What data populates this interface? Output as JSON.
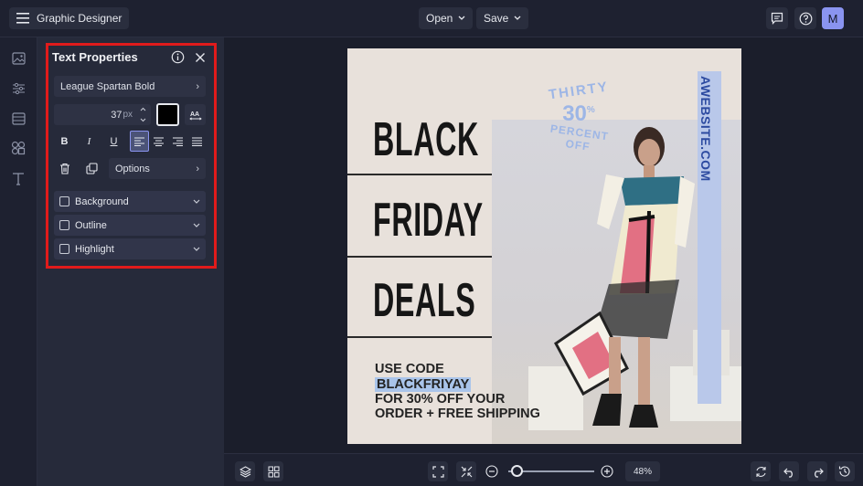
{
  "app": {
    "title": "Graphic Designer",
    "avatar_letter": "M"
  },
  "toolbar": {
    "open_label": "Open",
    "save_label": "Save"
  },
  "icons": [
    "hamburger-icon",
    "chevron-down-icon",
    "comment-icon",
    "help-icon",
    "image-icon",
    "sliders-icon",
    "layout-icon",
    "shapes-icon",
    "text-icon",
    "info-icon",
    "close-icon",
    "trash-icon",
    "duplicate-icon",
    "layers-icon",
    "grid-icon",
    "fit-icon",
    "shrink-icon",
    "zoom-out-icon",
    "zoom-in-icon",
    "refresh-icon",
    "undo-icon",
    "redo-icon",
    "history-icon"
  ],
  "text_properties": {
    "title": "Text Properties",
    "font": "League Spartan Bold",
    "size_value": "37",
    "size_unit": "px",
    "color": "#000000",
    "options_label": "Options",
    "accordions": [
      "Background",
      "Outline",
      "Highlight"
    ],
    "format_buttons": [
      "B",
      "I",
      "U"
    ]
  },
  "design": {
    "lines": [
      "BLACK",
      "FRIDAY",
      "DEALS"
    ],
    "promo": {
      "line1": "USE CODE",
      "code": "BLACKFRIYAY",
      "line3": "FOR 30% OFF YOUR",
      "line4": "ORDER + FREE SHIPPING"
    },
    "stamp": {
      "top": "THIRTY",
      "middle": "30",
      "sup": "%",
      "bottom": "PERCENT OFF"
    },
    "website": "AWEBSITE.COM"
  },
  "zoom": {
    "value": "48%",
    "level": 0.48
  },
  "colors": {
    "accent": "#e01b1b",
    "avatar": "#8a94f0",
    "highlight": "#a9c4ea",
    "stamp": "#9db6e6"
  }
}
